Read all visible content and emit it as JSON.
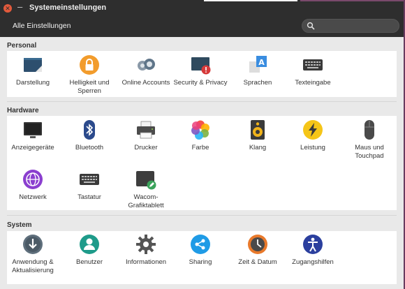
{
  "window": {
    "title": "Systemeinstellungen"
  },
  "header": {
    "all_settings_label": "Alle Einstellungen",
    "search_placeholder": ""
  },
  "sections": [
    {
      "title": "Personal",
      "items": [
        {
          "label": "Darstellung",
          "icon": "appearance-icon"
        },
        {
          "label": "Helligkeit und Sperren",
          "icon": "lock-icon"
        },
        {
          "label": "Online Accounts",
          "icon": "online-accounts-icon"
        },
        {
          "label": "Security & Privacy",
          "icon": "security-privacy-icon"
        },
        {
          "label": "Sprachen",
          "icon": "language-icon"
        },
        {
          "label": "Texteingabe",
          "icon": "keyboard-input-icon"
        }
      ]
    },
    {
      "title": "Hardware",
      "items": [
        {
          "label": "Anzeigegeräte",
          "icon": "display-icon"
        },
        {
          "label": "Bluetooth",
          "icon": "bluetooth-icon"
        },
        {
          "label": "Drucker",
          "icon": "printer-icon"
        },
        {
          "label": "Farbe",
          "icon": "color-icon"
        },
        {
          "label": "Klang",
          "icon": "speaker-icon"
        },
        {
          "label": "Leistung",
          "icon": "power-icon"
        },
        {
          "label": "Maus und Touchpad",
          "icon": "mouse-icon"
        },
        {
          "label": "Netzwerk",
          "icon": "network-icon"
        },
        {
          "label": "Tastatur",
          "icon": "keyboard-icon"
        },
        {
          "label": "Wacom-Grafiktablett",
          "icon": "wacom-tablet-icon"
        }
      ]
    },
    {
      "title": "System",
      "items": [
        {
          "label": "Anwendung & Aktualisierung",
          "icon": "software-updates-icon"
        },
        {
          "label": "Benutzer",
          "icon": "user-icon"
        },
        {
          "label": "Informationen",
          "icon": "gear-icon"
        },
        {
          "label": "Sharing",
          "icon": "share-icon"
        },
        {
          "label": "Zeit & Datum",
          "icon": "clock-icon"
        },
        {
          "label": "Zugangshilfen",
          "icon": "accessibility-icon"
        }
      ]
    }
  ],
  "colors": {
    "titlebar": "#2e2e2e",
    "close_button": "#e25a3c",
    "panel": "#ffffff",
    "background": "#e9e9e9"
  }
}
